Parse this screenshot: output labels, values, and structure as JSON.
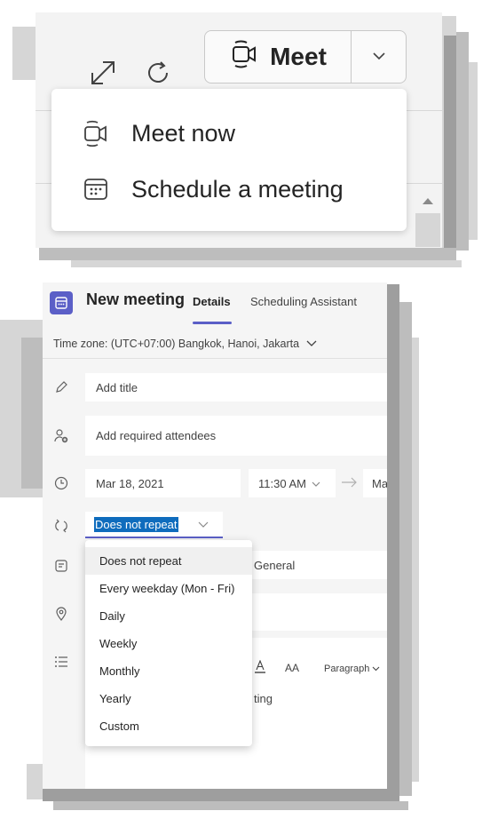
{
  "toolbar": {
    "expand_icon": "expand-diagonal-icon",
    "refresh_icon": "refresh-icon",
    "meet_button_label": "Meet",
    "meet_icon": "video-camera-icon",
    "meet_chevron_icon": "chevron-down-icon"
  },
  "meet_menu": {
    "items": [
      {
        "label": "Meet now",
        "icon": "video-camera-icon"
      },
      {
        "label": "Schedule a meeting",
        "icon": "calendar-icon"
      }
    ]
  },
  "form": {
    "title": "New meeting",
    "tabs": [
      {
        "label": "Details",
        "active": true
      },
      {
        "label": "Scheduling Assistant",
        "active": false
      }
    ],
    "timezone_label": "Time zone: (UTC+07:00) Bangkok, Hanoi, Jakarta",
    "title_placeholder": "Add title",
    "attendees_placeholder": "Add required attendees",
    "start_date": "Mar 18, 2021",
    "start_time": "11:30 AM",
    "end_date_partial": "Ma",
    "repeat_value": "Does not repeat",
    "channel_value": "General",
    "editor_paragraph_label": "Paragraph",
    "editor_font_size_label": "AA",
    "editor_text_partial": "ting"
  },
  "repeat_dropdown": {
    "options": [
      "Does not repeat",
      "Every weekday (Mon - Fri)",
      "Daily",
      "Weekly",
      "Monthly",
      "Yearly",
      "Custom"
    ],
    "selected_index": 0
  },
  "colors": {
    "accent": "#5b5fc7",
    "selection": "#0f6cbd",
    "panel_bg": "#f5f5f5"
  }
}
